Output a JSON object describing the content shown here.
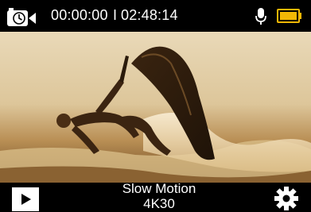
{
  "status_bar": {
    "elapsed_time": "00:00:00",
    "separator": "I",
    "remaining_time": "02:48:14",
    "icons": [
      "timelapse-camera-icon",
      "microphone-icon",
      "battery-icon"
    ],
    "battery_level": 1.0,
    "battery_color": "#f2b705"
  },
  "viewfinder": {
    "scene_description_icon": "live-preview"
  },
  "bottom_bar": {
    "mode_name": "Slow Motion",
    "resolution": "4K30",
    "icons": [
      "play-icon",
      "gear-icon"
    ]
  }
}
